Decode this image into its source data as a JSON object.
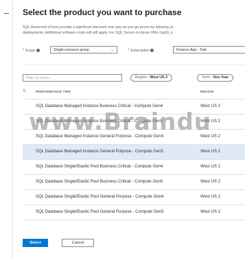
{
  "title": "Select the product you want to purchase",
  "description": {
    "line1": "SQL Reserved vCores provide a significant discount over pay-as-you-go prices by allowing yo",
    "line2": "deployments. Additional software costs will still apply. For SQL Server on Azure VMs (IaaS), p"
  },
  "scope": {
    "label": "Scope",
    "value": "Single resource group"
  },
  "subscription": {
    "label": "Subscription",
    "value": "Finance App - Test"
  },
  "filter": {
    "placeholder": "Filter by name..."
  },
  "region_pill": {
    "label": "Region : ",
    "value": "West US 2"
  },
  "term_pill": {
    "label": "Term : ",
    "value": "One Year"
  },
  "table": {
    "headers": {
      "performance_tier": "PERFORMANCE TIER",
      "region": "REGION"
    },
    "rows": [
      {
        "tier": "SQL Database Managed Instance Business Critical - Compute Gen4",
        "region": "West US 2"
      },
      {
        "tier": "SQL Database Managed Instance Business Critical - Compute Gen5",
        "region": "West US 2"
      },
      {
        "tier": "SQL Database Managed Instance General Purpose - Compute Gen4",
        "region": "West US 2"
      },
      {
        "tier": "SQL Database Managed Instance General Purpose - Compute Gen5",
        "region": "West US 2"
      },
      {
        "tier": "SQL Database Single/Elastic Pool Business Critical - Compute Gen4",
        "region": "West US 2"
      },
      {
        "tier": "SQL Database Single/Elastic Pool Business Critical - Compute Gen5",
        "region": "West US 2"
      },
      {
        "tier": "SQL Database Single/Elastic Pool General Purpose - Compute Gen4",
        "region": "West US 2"
      },
      {
        "tier": "SQL Database Single/Elastic Pool General Purpose - Compute Gen5",
        "region": "West US 2"
      }
    ]
  },
  "watermark": "www.Braindu",
  "buttons": {
    "select": "Select",
    "cancel": "Cancel"
  }
}
